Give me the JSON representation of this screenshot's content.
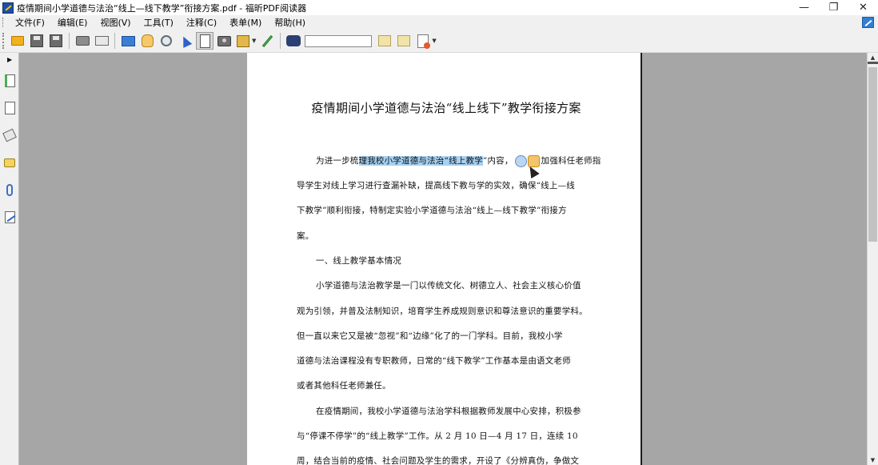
{
  "window": {
    "title": "疫情期间小学道德与法治“线上—线下教学”衔接方案.pdf - 福昕PDF阅读器",
    "minimize": "—",
    "restore": "❐",
    "close": "✕"
  },
  "menu": {
    "items": [
      "文件(F)",
      "编辑(E)",
      "视图(V)",
      "工具(T)",
      "注释(C)",
      "表单(M)",
      "帮助(H)"
    ]
  },
  "toolbar": {
    "search_value": "",
    "icons": [
      "open-folder-icon",
      "save-icon",
      "save-all-icon",
      "print-icon",
      "email-icon",
      "fullscreen-icon",
      "hand-icon",
      "zoom-icon",
      "select-arrow-icon",
      "select-text-icon",
      "snapshot-icon",
      "stamp-icon",
      "pen-icon",
      "find-icon",
      "prev-result-icon",
      "next-result-icon",
      "document-icon"
    ]
  },
  "document": {
    "title": "疫情期间小学道德与法治“线上线下”教学衔接方案",
    "lines": {
      "l1_a": "为进一步梳",
      "l1_hl": "理我校小学道德与法治“线上教学",
      "l1_b": "”内容，",
      "l1_c": "加强科任老师指",
      "l2": "导学生对线上学习进行查漏补缺，提高线下教与学的实效，确保“线上—线",
      "l3": "下教学”顺利衔接，特制定实验小学道德与法治“线上—线下教学”衔接方",
      "l4": "案。",
      "l5": "一、线上教学基本情况",
      "l6": "小学道德与法治教学是一门以传统文化、树德立人、社会主义核心价值",
      "l7": "观为引领，并普及法制知识，培育学生养成规则意识和尊法意识的重要学科。",
      "l8": "但一直以来它又是被“忽视”和“边缘”化了的一门学科。目前，我校小学",
      "l9": "道德与法治课程没有专职教师，日常的“线下教学”工作基本是由语文老师",
      "l10": "或者其他科任老师兼任。",
      "l11": "在疫情期间，我校小学道德与法治学科根据教师发展中心安排，积极参",
      "l12": "与“停课不停学”的“线上教学”工作。从 2 月 10 日—4 月 17 日，连续 10",
      "l13": "周，结合当前的疫情、社会问题及学生的需求，开设了《分辨真伪，争做文"
    }
  },
  "scrollbar": {
    "up": "▲",
    "down": "▼"
  },
  "leftpanel": {
    "toggle": "▶"
  }
}
